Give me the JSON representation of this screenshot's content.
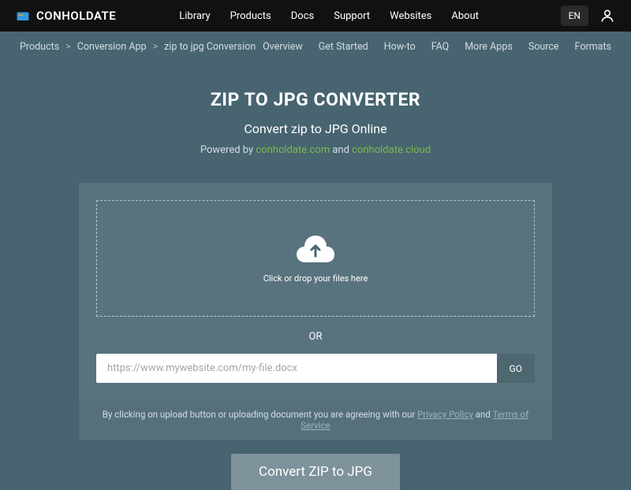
{
  "brand": {
    "name": "CONHOLDATE"
  },
  "topnav": [
    "Library",
    "Products",
    "Docs",
    "Support",
    "Websites",
    "About"
  ],
  "lang": "EN",
  "breadcrumb": [
    "Products",
    "Conversion App",
    "zip to jpg Conversion"
  ],
  "subnav": [
    "Overview",
    "Get Started",
    "How-to",
    "FAQ",
    "More Apps",
    "Source",
    "Formats"
  ],
  "hero": {
    "title": "ZIP TO JPG CONVERTER",
    "subtitle": "Convert zip to JPG Online",
    "powered_prefix": "Powered by ",
    "link1": "conholdate.com",
    "and": " and ",
    "link2": "conholdate.cloud"
  },
  "dropzone": {
    "text": "Click or drop your files here"
  },
  "or_label": "OR",
  "url": {
    "placeholder": "https://www.mywebsite.com/my-file.docx",
    "go": "GO"
  },
  "disclaimer": {
    "prefix": "By clicking on upload button or uploading document you are agreeing with our ",
    "privacy": "Privacy Policy",
    "and": " and ",
    "terms": "Terms of Service"
  },
  "convert_label": "Convert ZIP to JPG"
}
